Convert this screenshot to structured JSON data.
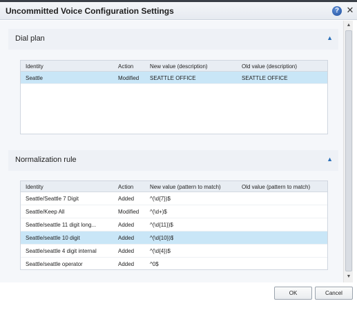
{
  "dialog": {
    "title": "Uncommitted Voice Configuration Settings",
    "help_icon_glyph": "?",
    "close_icon_glyph": "✕"
  },
  "dial_plan": {
    "title": "Dial plan",
    "columns": [
      "Identity",
      "Action",
      "New value (description)",
      "Old value (description)"
    ],
    "rows": [
      [
        "Seattle",
        "Modified",
        "SEATTLE OFFICE",
        "SEATTLE OFFICE"
      ]
    ],
    "selected_row": 0
  },
  "normalization_rule": {
    "title": "Normalization rule",
    "columns": [
      "Identity",
      "Action",
      "New value (pattern to match)",
      "Old value (pattern to match)"
    ],
    "rows": [
      [
        "Seattle/Seattle 7 Digit",
        "Added",
        "^(\\d{7})$",
        ""
      ],
      [
        "Seattle/Keep All",
        "Modified",
        "^(\\d+)$",
        ""
      ],
      [
        "Seattle/seattle 11 digit long...",
        "Added",
        "^(\\d{11})$",
        ""
      ],
      [
        "Seattle/seattle 10 digit",
        "Added",
        "^(\\d{10})$",
        ""
      ],
      [
        "Seattle/seattle 4 digit internal",
        "Added",
        "^(\\d{4})$",
        ""
      ],
      [
        "Seattle/seattle operator",
        "Added",
        "^0$",
        ""
      ]
    ],
    "selected_row": 3
  },
  "buttons": {
    "ok": "OK",
    "cancel": "Cancel"
  },
  "icons": {
    "collapse": "chevron-up-icon",
    "help": "help-icon",
    "close": "close-icon"
  },
  "colors": {
    "selection": "#c9e6f7",
    "accent": "#2a6fb8"
  }
}
